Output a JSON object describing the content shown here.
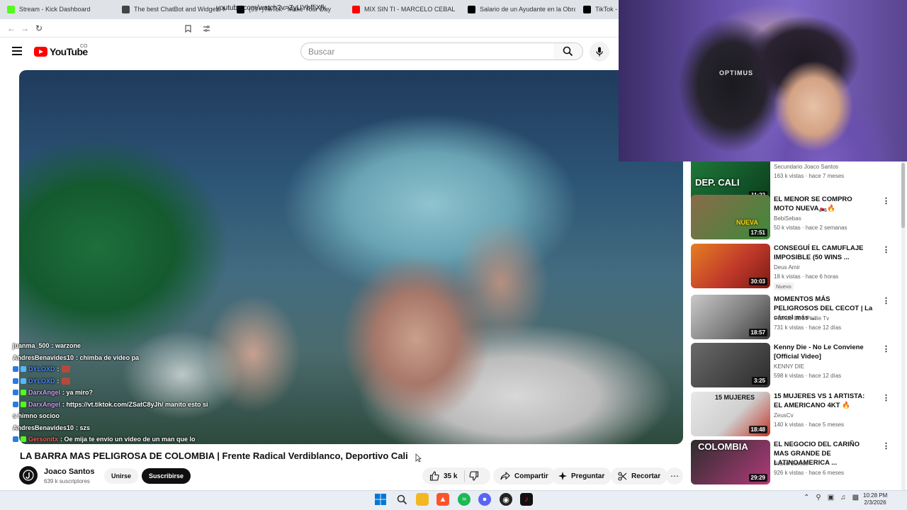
{
  "browser": {
    "tabs": [
      {
        "title": "Stream - Kick Dashboard",
        "color": "#53fc18"
      },
      {
        "title": "The best ChatBot and Widgets for K",
        "color": "#333333"
      },
      {
        "title": "(99+)TikTok - Make Your Day",
        "color": "#000000"
      },
      {
        "title": "MIX SIN TI - MARCELO CEBALLOS (v",
        "color": "#ff0000"
      },
      {
        "title": "Salario de un Ayudante en la Obra: l",
        "color": "#000000"
      },
      {
        "title": "TikTok - M",
        "color": "#000000"
      }
    ],
    "url": "youtube.com/watch?v=ZyUYbffiXfk"
  },
  "youtube": {
    "logo_text": "YouTube",
    "country_code": "CO",
    "search_placeholder": "Buscar"
  },
  "chat": [
    {
      "user": "juanma_500",
      "user_color": "#ffffff",
      "message": ": warzone"
    },
    {
      "user": "AndresBenavides10",
      "user_color": "#ffffff",
      "message": ": chimba de video pa"
    },
    {
      "user": "DYLOXD",
      "user_color": "#4d8bff",
      "message": ":"
    },
    {
      "user": "DYLOXD",
      "user_color": "#4d8bff",
      "message": ":"
    },
    {
      "user": "DarxAngel",
      "user_color": "#d29bff",
      "message": ": ya miro?"
    },
    {
      "user": "DarxAngel",
      "user_color": "#d29bff",
      "message": ": https://vt.tiktok.com/ZSatC8yJh/ manito esto si"
    },
    {
      "user": "",
      "user_color": "#ffffff",
      "message": "s himno socioo"
    },
    {
      "user": "AndresBenavides10",
      "user_color": "#ffffff",
      "message": ": szs"
    },
    {
      "user": "Gersonitx",
      "user_color": "#ff5a5a",
      "message": ": Oe mija te envío un video de un man que lo"
    }
  ],
  "video": {
    "title": "LA BARRA MAS PELIGROSA DE COLOMBIA | Frente Radical Verdiblanco, Deportivo Cali",
    "channel": "Joaco Santos",
    "subscribers": "639 k suscriptores",
    "join_label": "Unirse",
    "subscribe_label": "Suscribirse",
    "likes": "35 k",
    "share_label": "Compartir",
    "ask_label": "Preguntar",
    "clip_label": "Recortar"
  },
  "webcam": {
    "chair_brand": "OPTIMUS"
  },
  "sidebar": {
    "videos": [
      {
        "title": "",
        "channel": "Secundario Joaco Santos",
        "meta": "163 k vistas · hace 7 meses",
        "duration": "11:22",
        "thumb_text": "DEP. CALI",
        "colors": [
          "#1f7a3a",
          "#0b3d1e"
        ]
      },
      {
        "title": "EL MENOR SE COMPRO MOTO NUEVA🏍️🔥",
        "channel": "BebiSebas",
        "meta": "50 k vistas · hace 2 semanas",
        "duration": "17:51",
        "thumb_text": "NUEVA",
        "colors": [
          "#8a6a4a",
          "#3d8a3a"
        ]
      },
      {
        "title": "CONSEGUÍ EL CAMUFLAJE IMPOSIBLE (50 WINS ...",
        "channel": "Deus Amir",
        "meta": "18 k vistas · hace 6 horas",
        "duration": "30:03",
        "badge": "Nuevo",
        "thumb_text": "",
        "colors": [
          "#c0392b",
          "#e67e22"
        ]
      },
      {
        "title": "MOMENTOS MÁS PELIGROSOS DEL CECOT | La cárcel más ...",
        "channel": "Prende Otro Phillie Tv",
        "meta": "731 k vistas · hace 12 días",
        "duration": "18:57",
        "thumb_text": "",
        "colors": [
          "#7a7a7a",
          "#c9c9c9"
        ]
      },
      {
        "title": "Kenny Die - No Le Conviene [Official Video]",
        "channel": "KENNY DIE",
        "meta": "598 k vistas · hace 12 días",
        "duration": "3:25",
        "thumb_text": "",
        "colors": [
          "#2b2b2b",
          "#6a6a6a"
        ]
      },
      {
        "title": "15 MUJERES VS 1 ARTISTA: EL AMERICANO 4KT 🔥",
        "channel": "ZeusCv",
        "meta": "140 k vistas · hace 5 meses",
        "duration": "18:48",
        "thumb_text": "15 MUJERES",
        "colors": [
          "#e8e8e8",
          "#c0392b"
        ]
      },
      {
        "title": "EL NEGOCIO DEL CARIÑO MAS GRANDE DE LATINOAMERICA ...",
        "channel": "Joaco Santos",
        "meta": "926 k vistas · hace 6 meses",
        "duration": "29:29",
        "thumb_text": "COLOMBIA",
        "colors": [
          "#2d2d2d",
          "#b03a7a"
        ]
      }
    ]
  },
  "taskbar": {
    "time": "10:28 PM",
    "date": "2/3/2026",
    "icon_colors": {
      "windows": "#0078d4",
      "search": "#333333",
      "explorer": "#f2b822",
      "brave": "#fb542b",
      "spotify": "#1db954",
      "discord": "#5865f2",
      "obs": "#222222",
      "tiktok": "#ee1d52"
    }
  }
}
